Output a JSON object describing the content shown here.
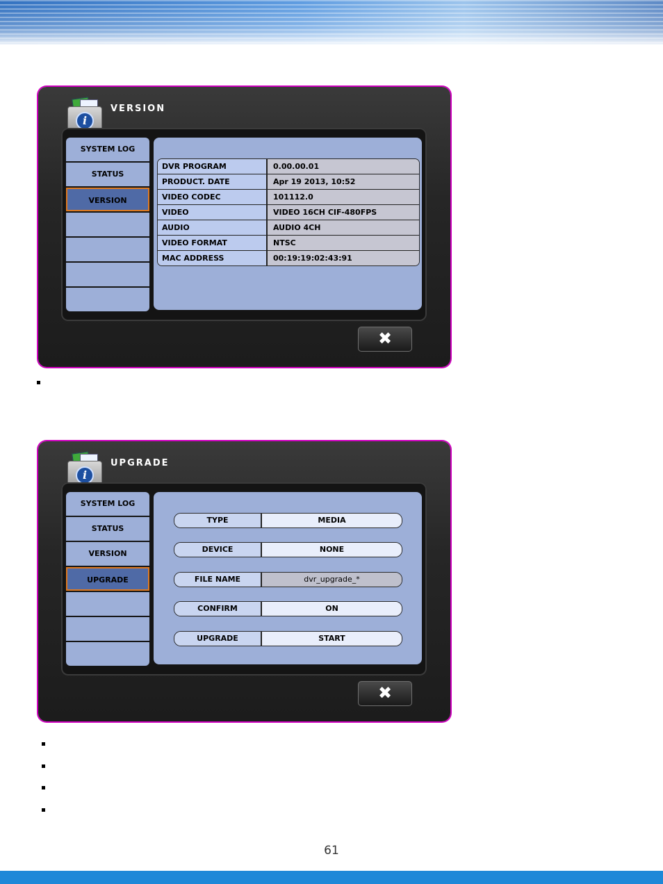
{
  "version_window": {
    "title": "VERSION",
    "sidebar": [
      "SYSTEM LOG",
      "STATUS",
      "VERSION",
      "",
      "",
      "",
      ""
    ],
    "rows": [
      {
        "label": "DVR PROGRAM",
        "value": "0.00.00.01"
      },
      {
        "label": "PRODUCT. DATE",
        "value": "Apr 19 2013, 10:52"
      },
      {
        "label": "VIDEO CODEC",
        "value": "101112.0"
      },
      {
        "label": "VIDEO",
        "value": "VIDEO 16CH CIF-480FPS"
      },
      {
        "label": "AUDIO",
        "value": "AUDIO 4CH"
      },
      {
        "label": "VIDEO FORMAT",
        "value": "NTSC"
      },
      {
        "label": "MAC ADDRESS",
        "value": "00:19:19:02:43:91"
      }
    ],
    "close_label": "✖"
  },
  "upgrade_window": {
    "title": "UPGRADE",
    "sidebar": [
      "SYSTEM LOG",
      "STATUS",
      "VERSION",
      "UPGRADE",
      "",
      "",
      ""
    ],
    "fields": [
      {
        "label": "TYPE",
        "value": "MEDIA"
      },
      {
        "label": "DEVICE",
        "value": "NONE"
      },
      {
        "label": "FILE NAME",
        "value": "dvr_upgrade_*"
      },
      {
        "label": "CONFIRM",
        "value": "ON"
      },
      {
        "label": "UPGRADE",
        "value": "START"
      }
    ],
    "close_label": "✖"
  },
  "page_number": "61"
}
